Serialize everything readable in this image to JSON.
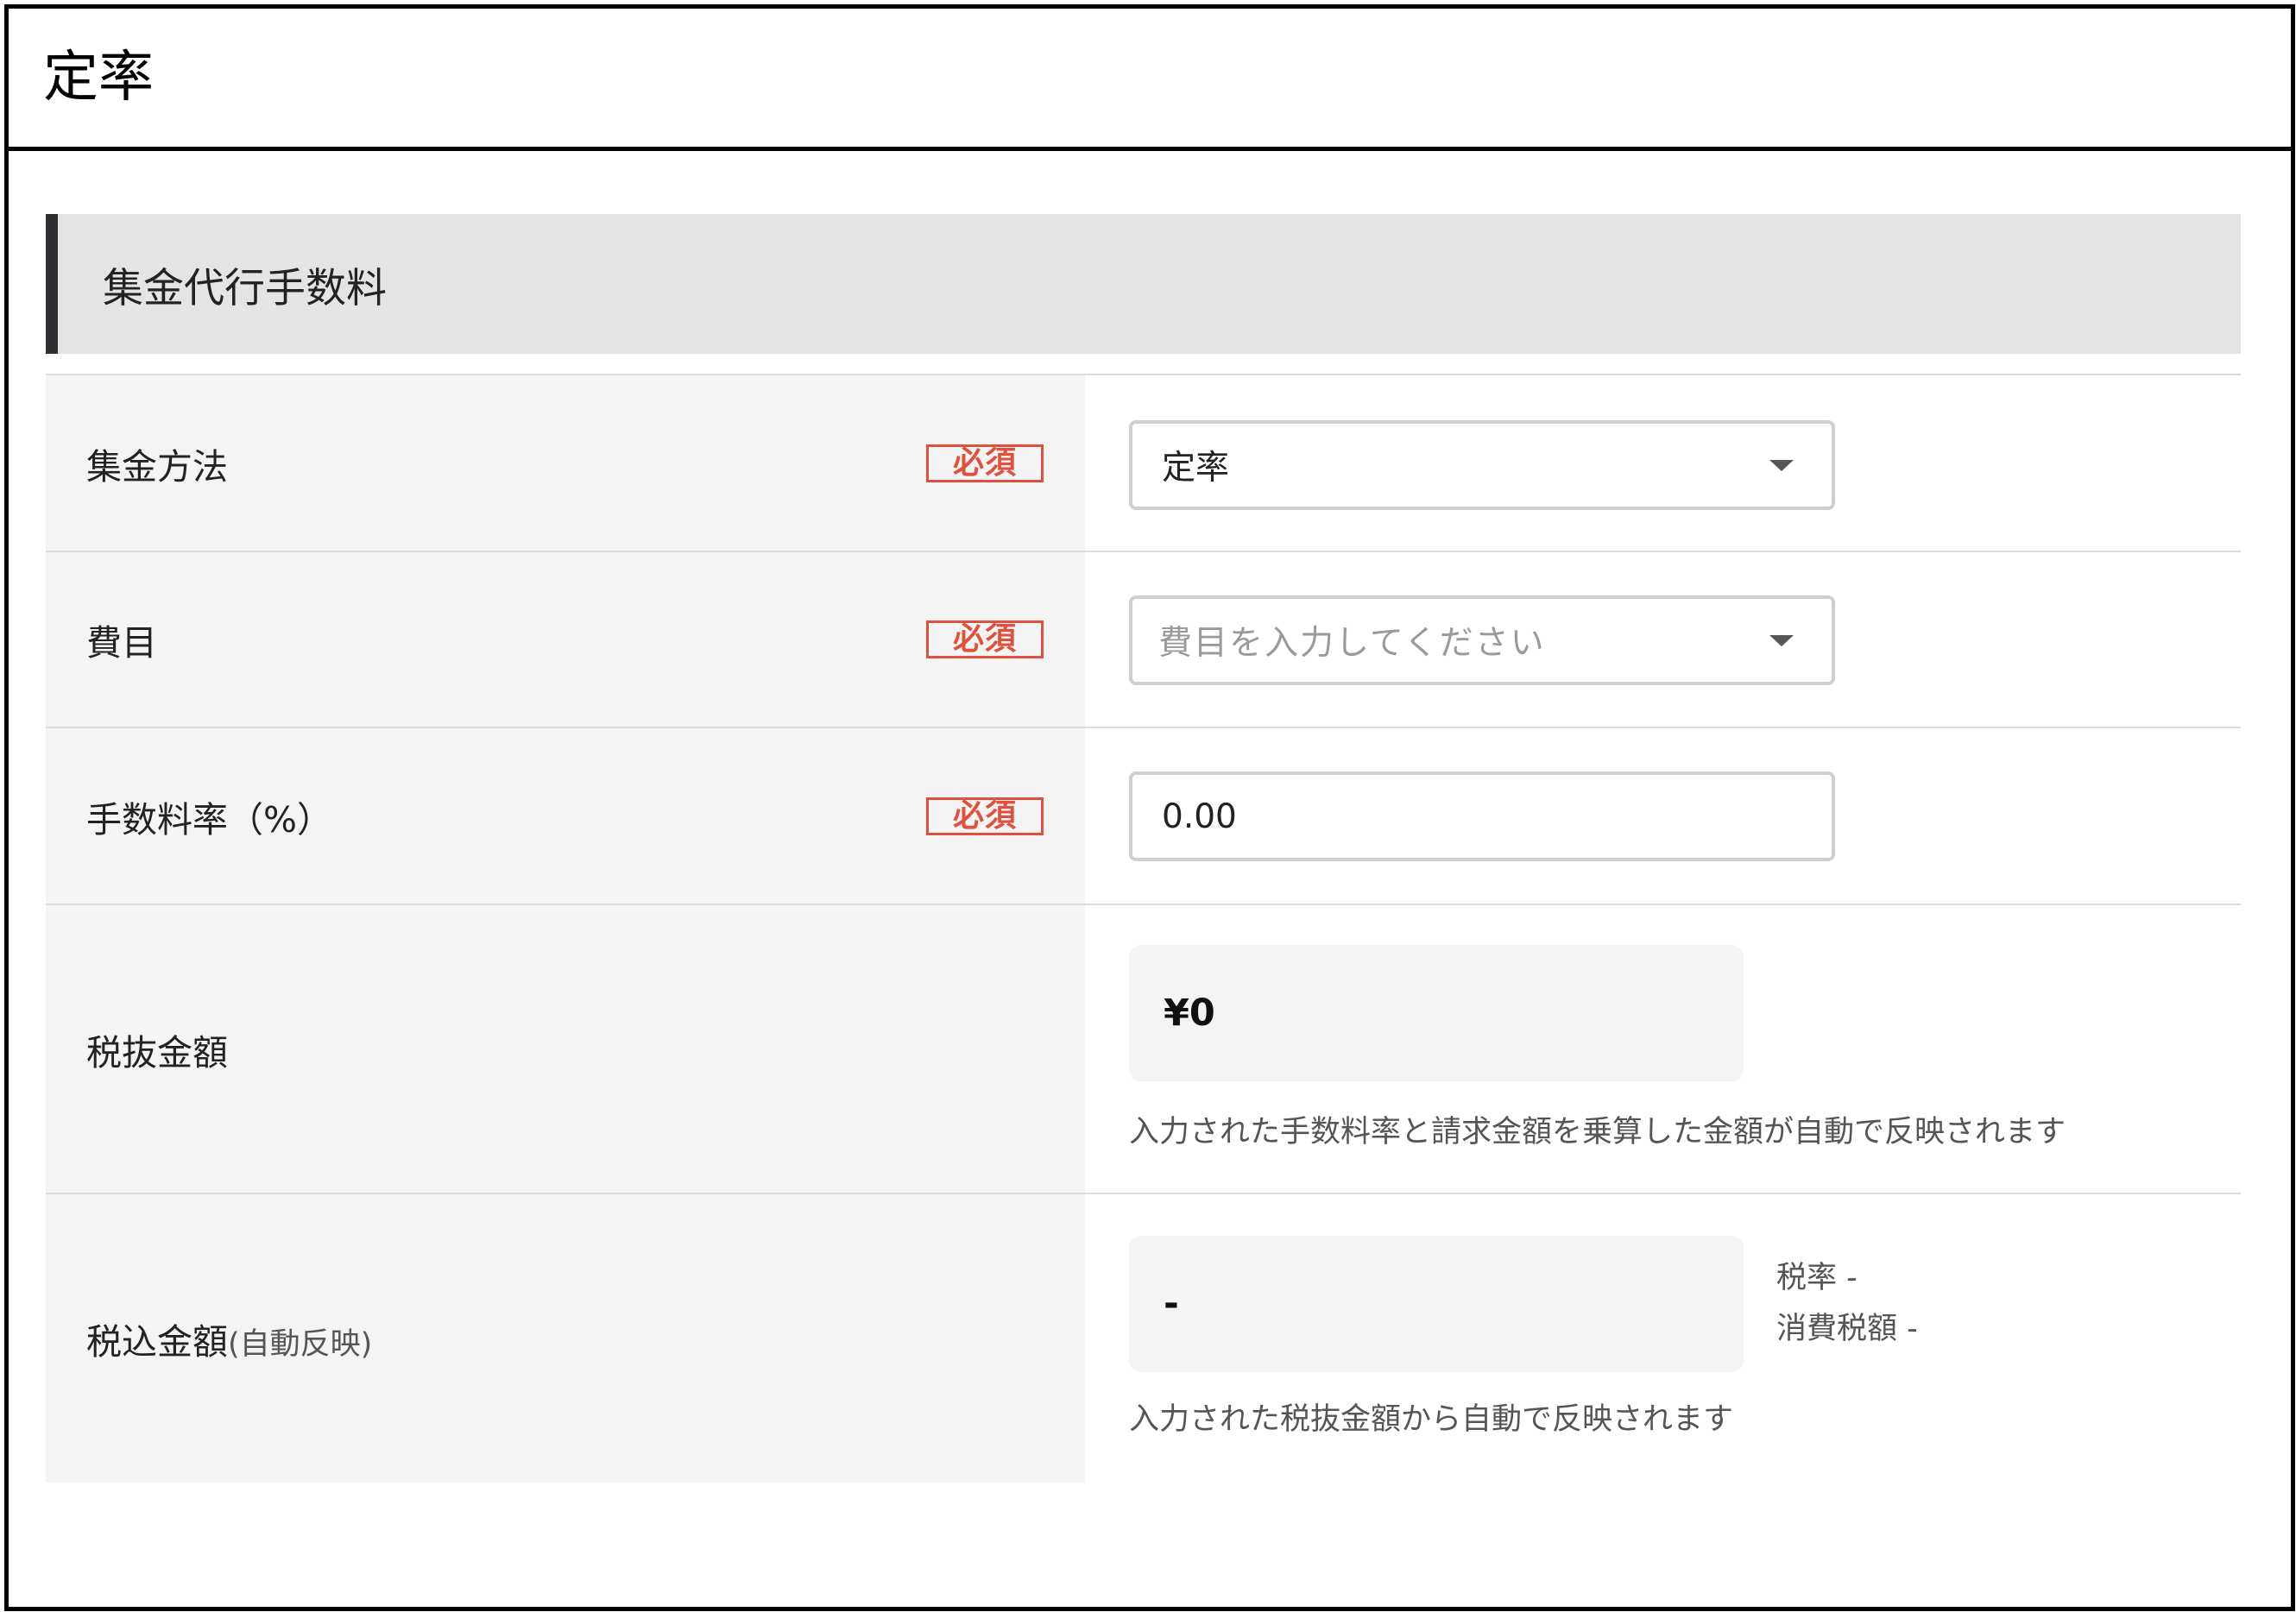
{
  "header": {
    "title": "定率"
  },
  "section": {
    "title": "集金代行手数料"
  },
  "required_label": "必須",
  "rows": {
    "method": {
      "label": "集金方法",
      "value": "定率"
    },
    "item": {
      "label": "費目",
      "placeholder": "費目を入力してください"
    },
    "rate": {
      "label": "手数料率（%）",
      "value": "0.00"
    },
    "net": {
      "label": "税抜金額",
      "value": "¥0",
      "hint": "入力された手数料率と請求金額を乗算した金額が自動で反映されます"
    },
    "gross": {
      "label": "税込金額",
      "label_suffix": "(自動反映)",
      "value": "-",
      "tax_rate": "税率 -",
      "consumption_tax": "消費税額 -",
      "hint": "入力された税抜金額から自動で反映されます"
    }
  },
  "icons": {
    "dropdown": "chevron-down-icon"
  }
}
